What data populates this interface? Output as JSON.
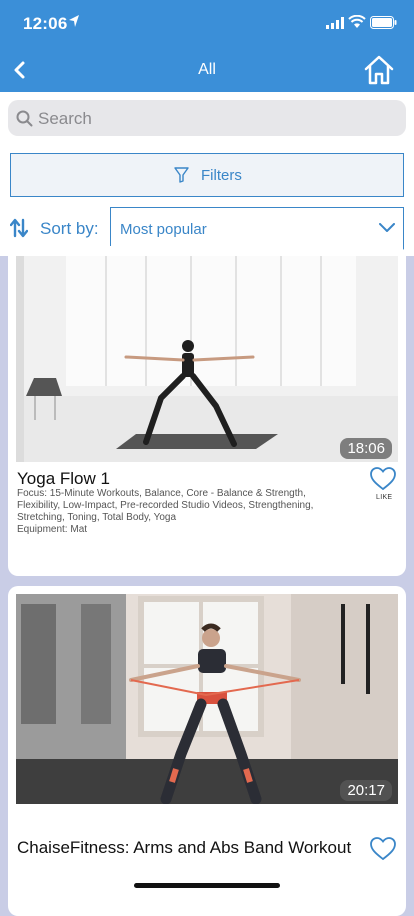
{
  "status_bar": {
    "time": "12:06"
  },
  "nav": {
    "title": "All"
  },
  "search": {
    "placeholder": "Search"
  },
  "filters": {
    "label": "Filters"
  },
  "sort": {
    "label": "Sort by:",
    "value": "Most popular"
  },
  "colors": {
    "accent": "#3b8fd8",
    "link": "#3a86c8",
    "background": "#c9cde6"
  },
  "workouts": [
    {
      "title": "Yoga Flow 1",
      "duration": "18:06",
      "focus": "Focus: 15-Minute Workouts, Balance, Core - Balance & Strength, Flexibility, Low-Impact, Pre-recorded Studio Videos, Strengthening, Stretching, Toning, Total Body, Yoga",
      "equipment": "Equipment: Mat",
      "like_label": "LIKE"
    },
    {
      "title": "ChaiseFitness: Arms and Abs Band Workout",
      "duration": "20:17"
    }
  ]
}
